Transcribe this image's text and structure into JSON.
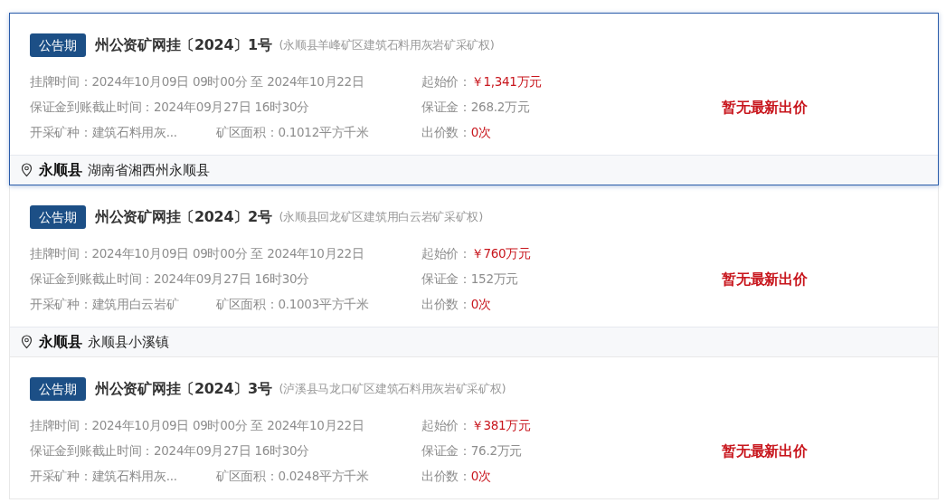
{
  "lots": [
    {
      "selected": true,
      "status": "公告期",
      "title": "州公资矿网挂〔2024〕1号",
      "subtitle": "(永顺县羊峰矿区建筑石料用灰岩矿采矿权)",
      "listing_time": {
        "label": "挂牌时间：",
        "value": "2024年10月09日 09时00分 至 2024年10月22日"
      },
      "start_price": {
        "label": "起始价：",
        "value": "￥1,341万元"
      },
      "deposit_deadline": {
        "label": "保证金到账截止时间：",
        "value": "2024年09月27日 16时30分"
      },
      "deposit": {
        "label": "保证金：",
        "value": "268.2万元"
      },
      "mineral": {
        "label": "开采矿种：",
        "value": "建筑石料用灰..."
      },
      "area": {
        "label": "矿区面积：",
        "value": "0.1012平方千米"
      },
      "bids": {
        "label": "出价数：",
        "value": "0次"
      },
      "latest_bid": "暂无最新出价",
      "location": {
        "county": "永顺县",
        "address": "湖南省湘西州永顺县"
      }
    },
    {
      "selected": false,
      "status": "公告期",
      "title": "州公资矿网挂〔2024〕2号",
      "subtitle": "(永顺县回龙矿区建筑用白云岩矿采矿权)",
      "listing_time": {
        "label": "挂牌时间：",
        "value": "2024年10月09日 09时00分 至 2024年10月22日"
      },
      "start_price": {
        "label": "起始价：",
        "value": "￥760万元"
      },
      "deposit_deadline": {
        "label": "保证金到账截止时间：",
        "value": "2024年09月27日 16时30分"
      },
      "deposit": {
        "label": "保证金：",
        "value": "152万元"
      },
      "mineral": {
        "label": "开采矿种：",
        "value": "建筑用白云岩矿"
      },
      "area": {
        "label": "矿区面积：",
        "value": "0.1003平方千米"
      },
      "bids": {
        "label": "出价数：",
        "value": "0次"
      },
      "latest_bid": "暂无最新出价",
      "location": {
        "county": "永顺县",
        "address": "永顺县小溪镇"
      }
    },
    {
      "selected": false,
      "status": "公告期",
      "title": "州公资矿网挂〔2024〕3号",
      "subtitle": "(泸溪县马龙口矿区建筑石料用灰岩矿采矿权)",
      "listing_time": {
        "label": "挂牌时间：",
        "value": "2024年10月09日 09时00分 至 2024年10月22日"
      },
      "start_price": {
        "label": "起始价：",
        "value": "￥381万元"
      },
      "deposit_deadline": {
        "label": "保证金到账截止时间：",
        "value": "2024年09月27日 16时30分"
      },
      "deposit": {
        "label": "保证金：",
        "value": "76.2万元"
      },
      "mineral": {
        "label": "开采矿种：",
        "value": "建筑石料用灰..."
      },
      "area": {
        "label": "矿区面积：",
        "value": "0.0248平方千米"
      },
      "bids": {
        "label": "出价数：",
        "value": "0次"
      },
      "latest_bid": "暂无最新出价"
    }
  ]
}
